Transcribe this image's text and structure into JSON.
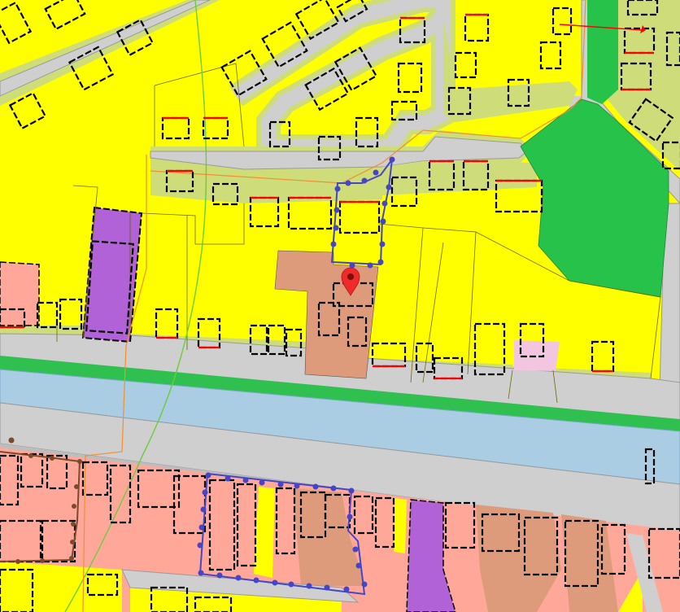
{
  "map": {
    "colors": {
      "residential": "#ffff00",
      "garden": "#cfdc7a",
      "road": "#cfcfcf",
      "road_edge": "#9a9a9a",
      "water": "#abcde4",
      "green_area": "#27c24a",
      "green_strip": "#30c050",
      "mixed_use": "#ffa89a",
      "business": "#de9b7b",
      "social": "#b062d6",
      "light_pink": "#f2c6e0",
      "boundary_orange": "#f09030",
      "boundary_green": "#6ccc3a",
      "selection_outline": "#4545c8",
      "location_marker": "#ee2a2a",
      "dimension_line": "#ff0000"
    },
    "icons": {
      "marker": "location-pin-icon"
    },
    "layers": [
      "residential",
      "garden",
      "road",
      "water",
      "green",
      "mixed-use",
      "business",
      "social",
      "selected-parcel"
    ]
  }
}
